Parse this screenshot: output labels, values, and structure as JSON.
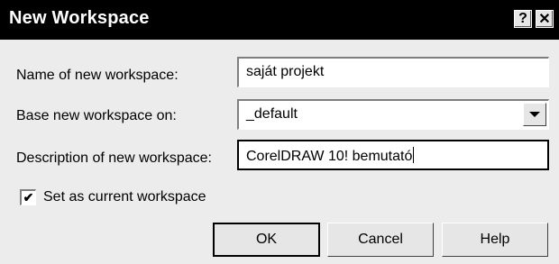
{
  "window": {
    "title": "New Workspace",
    "help_button": "?",
    "close_button": "✕"
  },
  "form": {
    "name_label": "Name of new workspace:",
    "name_value": "saját projekt",
    "base_label": "Base new workspace on:",
    "base_value": "_default",
    "description_label": "Description of new workspace:",
    "description_value": "CorelDRAW 10! bemutató",
    "set_current_label": "Set as current workspace",
    "set_current_checked": "✔"
  },
  "buttons": {
    "ok": "OK",
    "cancel": "Cancel",
    "help": "Help"
  }
}
